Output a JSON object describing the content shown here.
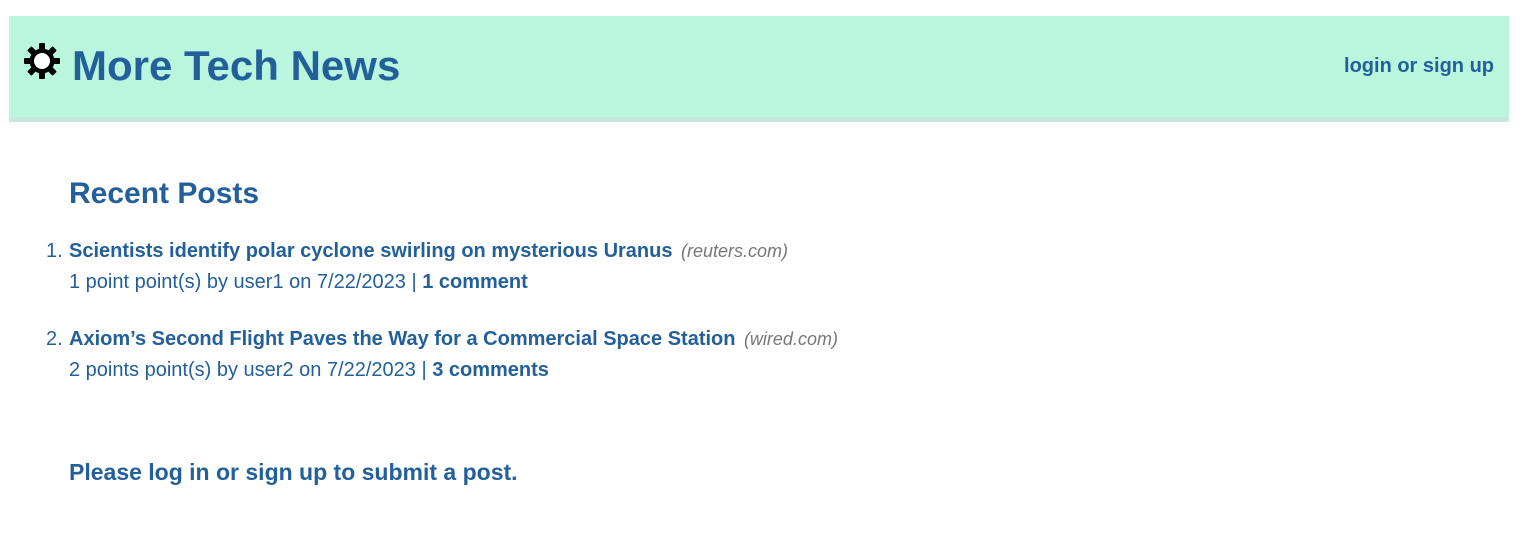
{
  "header": {
    "title": "More Tech News",
    "logo_icon": "gear-icon",
    "auth_link": "login or sign up",
    "background_color": "#baf6dd"
  },
  "main": {
    "section_title": "Recent Posts",
    "posts": [
      {
        "number": "1.",
        "title": "Scientists identify polar cyclone swirling on mysterious Uranus",
        "domain": "(reuters.com)",
        "meta": "1 point point(s) by user1 on 7/22/2023 |",
        "comments": "1 comment"
      },
      {
        "number": "2.",
        "title": "Axiom’s Second Flight Paves the Way for a Commercial Space Station",
        "domain": "(wired.com)",
        "meta": "2 points point(s) by user2 on 7/22/2023 |",
        "comments": "3 comments"
      }
    ],
    "notice": "Please log in or sign up to submit a post."
  },
  "colors": {
    "link": "#23609b",
    "domain": "#777777"
  }
}
